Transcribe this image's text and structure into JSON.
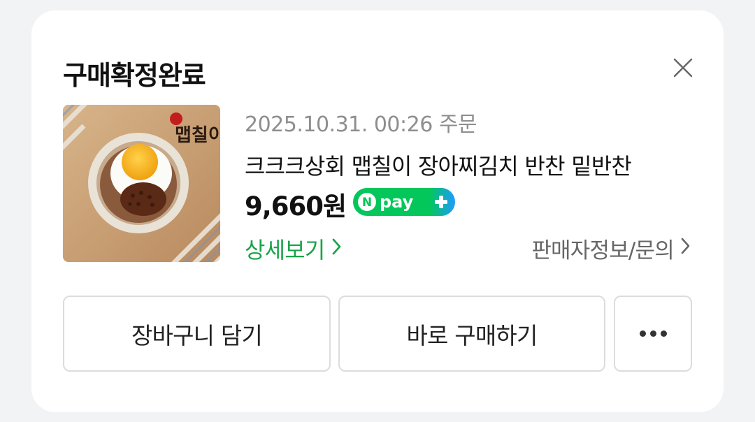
{
  "card": {
    "title": "구매확정완료",
    "close_icon": "close-icon"
  },
  "order": {
    "date": "2025.10.31. 00:26 주문",
    "product_name": "크크크상회 맵칠이 장아찌김치 반찬 밑반찬",
    "price": "9,660원",
    "payment_badge": {
      "text": "pay",
      "logo_letter": "N",
      "colors": {
        "start": "#03c75a",
        "end": "#1e9bff"
      }
    },
    "thumbnail_logo_text": "맵칠이",
    "detail_link": "상세보기",
    "seller_link": "판매자정보/문의"
  },
  "actions": {
    "cart_label": "장바구니 담기",
    "buy_label": "바로 구매하기",
    "more_icon": "more-dots-icon"
  },
  "colors": {
    "accent_green": "#1aa34a",
    "muted_text": "#8e8e8e",
    "border": "#dcdcdc"
  }
}
